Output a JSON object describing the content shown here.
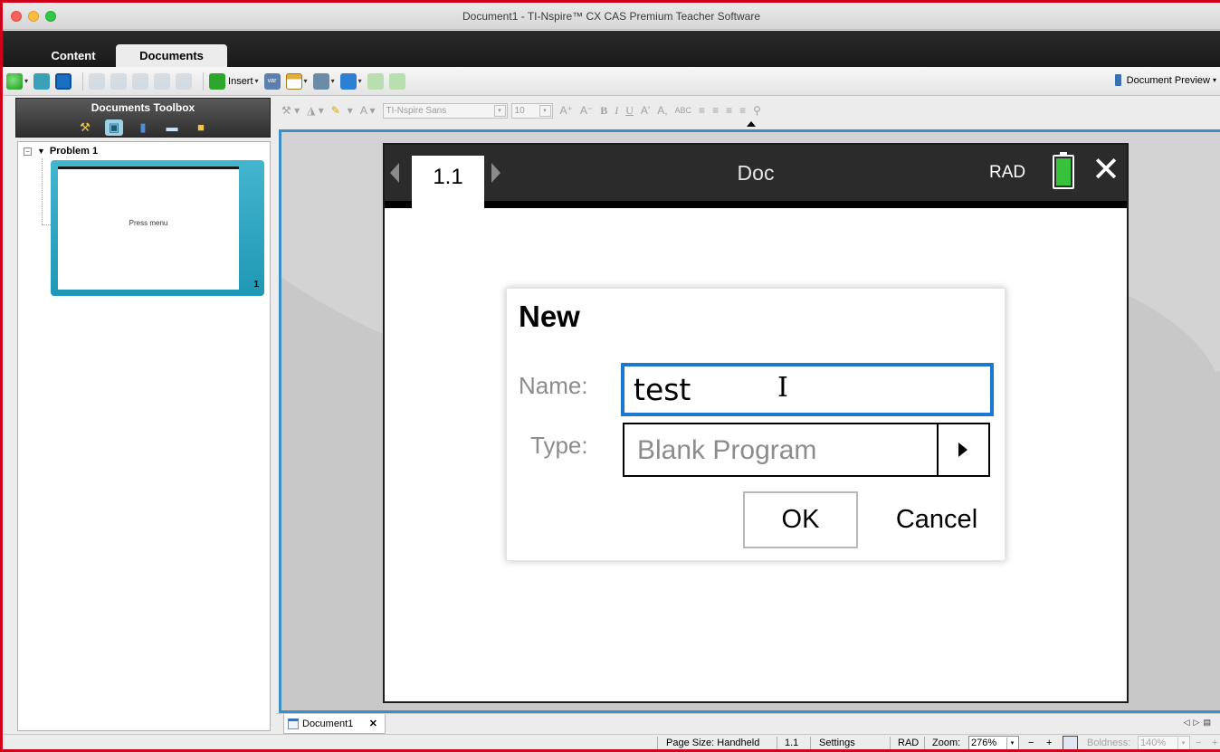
{
  "window": {
    "title": "Document1 - TI-Nspire™ CX CAS Premium Teacher Software"
  },
  "tabs": [
    {
      "label": "Content"
    },
    {
      "label": "Documents"
    }
  ],
  "toolbar": {
    "insert_label": "Insert",
    "doc_preview_label": "Document Preview"
  },
  "toolbox": {
    "title": "Documents Toolbox"
  },
  "tree": {
    "problem_label": "Problem 1",
    "page_text": "Press menu",
    "page_number": "1"
  },
  "format_toolbar": {
    "font": "TI-Nspire Sans",
    "size": "10"
  },
  "handheld": {
    "page_tab": "1.1",
    "doc_title": "Doc",
    "angle_mode": "RAD",
    "battery_color": "#36c23a"
  },
  "dialog": {
    "title": "New",
    "name_label": "Name:",
    "name_value": "test",
    "type_label": "Type:",
    "type_value": "Blank Program",
    "ok_label": "OK",
    "cancel_label": "Cancel",
    "focus_color": "#1a78d0"
  },
  "doc_tab": {
    "label": "Document1",
    "close": "✕"
  },
  "status": {
    "page_size": "Page Size: Handheld",
    "page": "1.1",
    "settings": "Settings",
    "angle": "RAD",
    "zoom_label": "Zoom:",
    "zoom_value": "276%",
    "minus": "−",
    "plus": "+",
    "boldness_label": "Boldness:",
    "boldness_value": "140%"
  }
}
